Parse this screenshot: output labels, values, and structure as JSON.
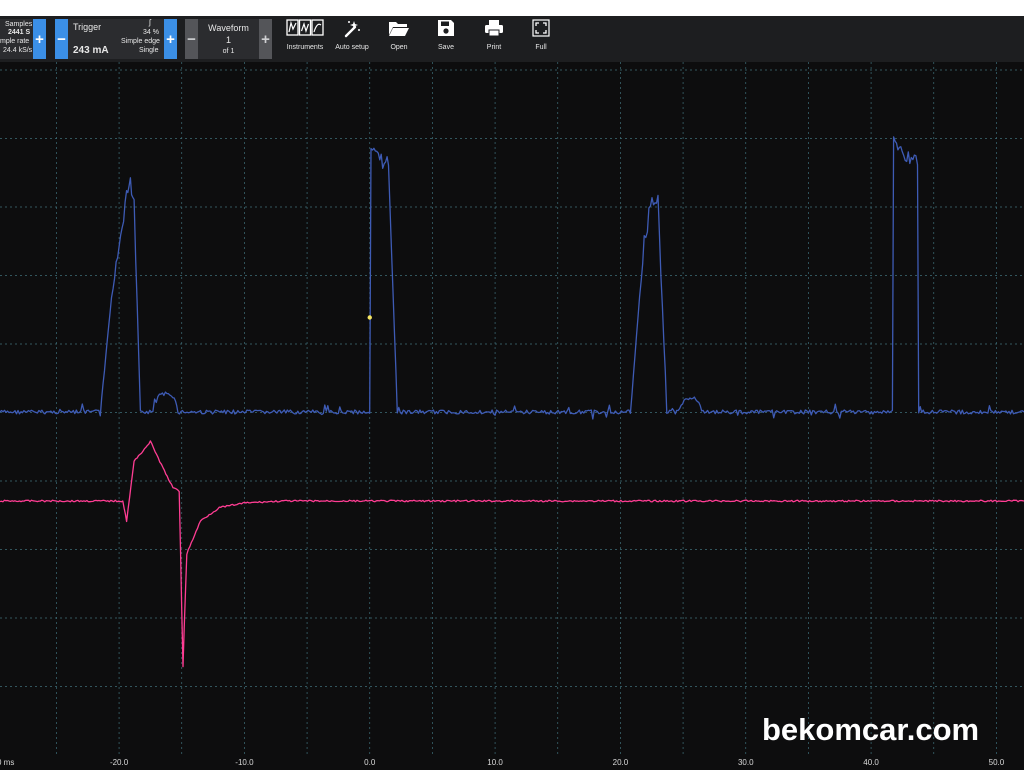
{
  "toolbar": {
    "samples": {
      "label": "Samples",
      "count": "2441 S",
      "rate_label": "mple rate",
      "rate": "24.4 kS/s",
      "plus": "+"
    },
    "trigger": {
      "minus": "−",
      "label": "Trigger",
      "value": "243 mA",
      "edge_symbol": "ʃ",
      "percent": "34 %",
      "mode": "Simple edge",
      "single": "Single",
      "plus": "+"
    },
    "waveform": {
      "minus": "−",
      "label": "Waveform",
      "number": "1",
      "of": "of 1",
      "plus": "+"
    },
    "tools": [
      {
        "label": "Instruments",
        "icon": "instruments-icon"
      },
      {
        "label": "Auto setup",
        "icon": "auto-setup-wand-icon"
      },
      {
        "label": "Open",
        "icon": "folder-open-icon"
      },
      {
        "label": "Save",
        "icon": "save-disk-icon"
      },
      {
        "label": "Print",
        "icon": "printer-icon"
      },
      {
        "label": "Full",
        "icon": "fullscreen-icon"
      }
    ]
  },
  "x_axis": {
    "unit_fragment": "0 ms",
    "ticks": [
      "-20.0",
      "-10.0",
      "0.0",
      "10.0",
      "20.0",
      "30.0",
      "40.0",
      "50.0"
    ]
  },
  "colors": {
    "background": "#0d0d0e",
    "grid": "#3f6f7a",
    "channel_a": "#3e5bb5",
    "channel_b": "#ff3d93",
    "trigger_marker": "#f5e663"
  },
  "chart_data": {
    "type": "line",
    "xlim": [
      -29.5,
      52.2
    ],
    "grid": true,
    "series": [
      {
        "color": "#3e5bb5",
        "points": [
          [
            -29.5,
            0
          ],
          [
            -21.5,
            0
          ],
          [
            -20.6,
            2.5
          ],
          [
            -19.4,
            4.9
          ],
          [
            -19.1,
            5.1
          ],
          [
            -18.8,
            4.7
          ],
          [
            -18.3,
            0
          ],
          [
            -17.3,
            0
          ],
          [
            -16.9,
            0.35
          ],
          [
            -16.3,
            0.4
          ],
          [
            -15.6,
            0.35
          ],
          [
            -15.3,
            0
          ],
          [
            0,
            0
          ],
          [
            0.1,
            5.8
          ],
          [
            0.8,
            5.6
          ],
          [
            1.5,
            5.5
          ],
          [
            2.2,
            0
          ],
          [
            20.8,
            0
          ],
          [
            21.9,
            3.8
          ],
          [
            22.4,
            4.7
          ],
          [
            23,
            4.7
          ],
          [
            23.7,
            0
          ],
          [
            24.6,
            0
          ],
          [
            25.2,
            0.3
          ],
          [
            25.9,
            0.35
          ],
          [
            26.6,
            0
          ],
          [
            41.7,
            0
          ],
          [
            41.8,
            6.0
          ],
          [
            42.6,
            5.7
          ],
          [
            43.7,
            5.6
          ],
          [
            43.8,
            0
          ],
          [
            52.2,
            0
          ]
        ]
      },
      {
        "color": "#ff3d93",
        "points": [
          [
            -29.5,
            0
          ],
          [
            -19.7,
            0
          ],
          [
            -19.4,
            -0.3
          ],
          [
            -18.8,
            0.6
          ],
          [
            -17.5,
            0.9
          ],
          [
            -16.5,
            0.5
          ],
          [
            -15.7,
            0.2
          ],
          [
            -15.2,
            0.15
          ],
          [
            -14.9,
            -2.5
          ],
          [
            -14.6,
            -0.8
          ],
          [
            -13.5,
            -0.3
          ],
          [
            -12,
            -0.1
          ],
          [
            -10,
            -0.03
          ],
          [
            -7,
            0
          ],
          [
            52.2,
            0
          ]
        ]
      }
    ],
    "trigger_point": [
      0,
      2.1
    ]
  },
  "watermark": "bekomcar.com"
}
